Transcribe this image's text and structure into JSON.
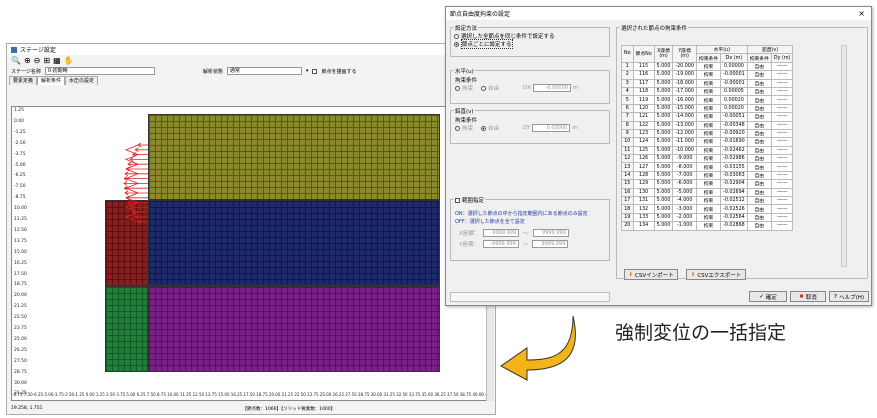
{
  "bg": {
    "title": "ステージ設定",
    "stage_label": "ステージ名称",
    "stage_value": "0.初期時",
    "analysis_label": "解析状態",
    "analysis_value": "通常",
    "show_nodes": "節点を描画する",
    "tabs": [
      "要素定義",
      "解析条件",
      "水圧の設定"
    ],
    "y_ticks": [
      "1.25",
      "0.00",
      "-1.25",
      "-2.50",
      "-3.75",
      "-5.00",
      "-6.25",
      "-7.50",
      "-8.75",
      "10.00",
      "11.25",
      "12.50",
      "13.75",
      "15.00",
      "16.25",
      "17.50",
      "18.75",
      "20.00",
      "21.25",
      "22.50",
      "23.75",
      "25.00",
      "26.25",
      "27.50",
      "28.75",
      "30.00",
      "31.25"
    ],
    "x_axis": "-8.75-7.50-6.25-5.00-3.75-2.50-1.25 0.00 1.25 2.50 3.75 5.00 6.25 7.50 8.75 10.00 11.25 12.50 13.75 15.00 16.25 17.50 18.75 20.00 21.25 22.50 23.75 25.00 26.25 27.50 28.75 30.00 31.25 32.50 33.75 35.00 36.25 37.50 38.75 40.00 41.25 42.50",
    "status_coord": "19.258, 1.751",
    "status_nodes": "【節点数：1066】【ソリッド要素数：1000】"
  },
  "dlg": {
    "title": "節点自由度拘束の設定",
    "close": "×",
    "method_group": "設定方法",
    "method_opt1": "選択した全節点を同じ条件で設定する",
    "method_opt2": "節点ごとに設定する",
    "horiz_group": "水平(u)",
    "vert_group": "鉛直(v)",
    "cond_label": "拘束条件",
    "fix": "拘束",
    "free": "自由",
    "dx_label": "DX",
    "dy_label": "DY",
    "dx_value": "-0.00000",
    "dy_value": "0.00000",
    "unit_m": "m",
    "range_check": "範囲指定",
    "range_note1": "ON：選択した節点の中から指定範囲内にある節点のみ設定",
    "range_note2": "OFF：選択した節点を全て設定",
    "x_coord": "X座標：",
    "y_coord": "Y座標：",
    "x_min": "-9999.999",
    "x_max": "9999.999",
    "y_min": "-9999.999",
    "y_max": "9999.999",
    "tilde": "～",
    "table_group": "選択された節点の拘束条件",
    "col_no": "No",
    "col_node": "節点No",
    "col_x": "X座標\n(m)",
    "col_y": "Y座標\n(m)",
    "col_h": "水平(u)",
    "col_v": "鉛直(v)",
    "col_cond": "拘束条件",
    "col_dx": "Dx (m)",
    "col_dy": "Dy (m)",
    "rows": [
      [
        "1",
        "115",
        "5.000",
        "-20.000",
        "拘束",
        "0.00000",
        "自由",
        "------"
      ],
      [
        "2",
        "116",
        "5.000",
        "-19.000",
        "拘束",
        "-0.00001",
        "自由",
        "------"
      ],
      [
        "3",
        "117",
        "5.000",
        "-18.000",
        "拘束",
        "-0.00001",
        "自由",
        "------"
      ],
      [
        "4",
        "118",
        "5.000",
        "-17.000",
        "拘束",
        "0.00005",
        "自由",
        "------"
      ],
      [
        "5",
        "119",
        "5.000",
        "-16.000",
        "拘束",
        "0.00020",
        "自由",
        "------"
      ],
      [
        "6",
        "120",
        "5.000",
        "-15.000",
        "拘束",
        "0.00020",
        "自由",
        "------"
      ],
      [
        "7",
        "121",
        "5.000",
        "-14.000",
        "拘束",
        "-0.00051",
        "自由",
        "------"
      ],
      [
        "8",
        "122",
        "5.000",
        "-13.000",
        "拘束",
        "-0.00348",
        "自由",
        "------"
      ],
      [
        "9",
        "123",
        "5.000",
        "-12.000",
        "拘束",
        "-0.00920",
        "自由",
        "------"
      ],
      [
        "10",
        "124",
        "5.000",
        "-11.000",
        "拘束",
        "-0.01690",
        "自由",
        "------"
      ],
      [
        "11",
        "125",
        "5.000",
        "-10.000",
        "拘束",
        "-0.02462",
        "自由",
        "------"
      ],
      [
        "12",
        "126",
        "5.000",
        "-9.000",
        "拘束",
        "-0.02986",
        "自由",
        "------"
      ],
      [
        "13",
        "127",
        "5.000",
        "-8.000",
        "拘束",
        "-0.03155",
        "自由",
        "------"
      ],
      [
        "14",
        "128",
        "5.000",
        "-7.000",
        "拘束",
        "-0.03063",
        "自由",
        "------"
      ],
      [
        "15",
        "129",
        "5.000",
        "-6.000",
        "拘束",
        "-0.02904",
        "自由",
        "------"
      ],
      [
        "16",
        "130",
        "5.000",
        "-5.000",
        "拘束",
        "-0.02694",
        "自由",
        "------"
      ],
      [
        "17",
        "131",
        "5.000",
        "-4.000",
        "拘束",
        "-0.02512",
        "自由",
        "------"
      ],
      [
        "18",
        "132",
        "5.000",
        "-3.000",
        "拘束",
        "-0.02526",
        "自由",
        "------"
      ],
      [
        "19",
        "133",
        "5.000",
        "-2.000",
        "拘束",
        "-0.02564",
        "自由",
        "------"
      ],
      [
        "20",
        "134",
        "5.000",
        "-1.000",
        "拘束",
        "-0.02868",
        "自由",
        "------"
      ]
    ],
    "csv_import": "CSVインポート",
    "csv_export": "CSVエクスポート",
    "ok": "確定",
    "cancel": "取消",
    "help": "ヘルプ(H)"
  },
  "caption": "強制変位の一括指定",
  "colors": {
    "arrow": "#f2b418",
    "olive": "#8a8a2c",
    "navy": "#1f2a6a",
    "red": "#8a1d1d",
    "purple": "#7b2088",
    "green": "#20803a",
    "load": "#e02020"
  }
}
